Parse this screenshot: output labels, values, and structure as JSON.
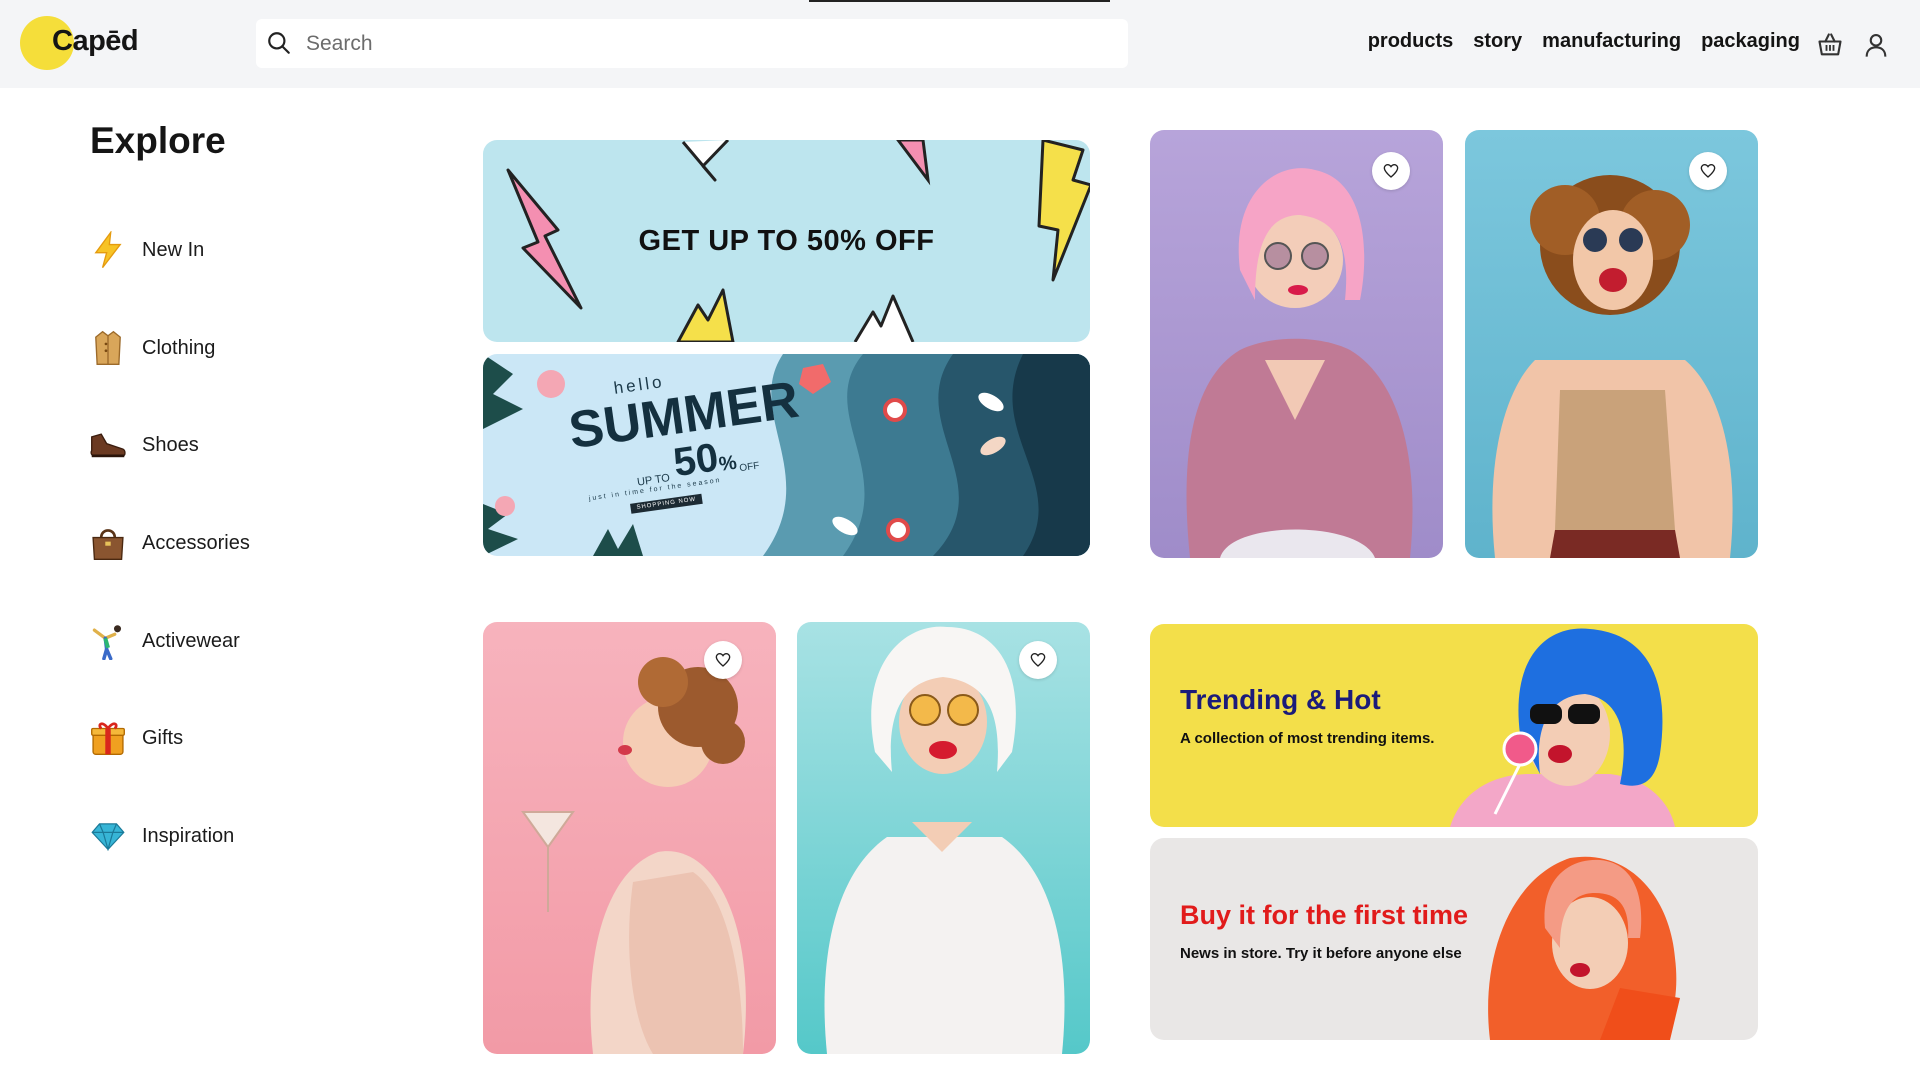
{
  "header": {
    "logo_text": "Capēd",
    "search_placeholder": "Search",
    "nav": [
      "products",
      "story",
      "manufacturing",
      "packaging"
    ]
  },
  "sidebar": {
    "title": "Explore",
    "items": [
      {
        "label": "New In",
        "icon": "lightning-icon"
      },
      {
        "label": "Clothing",
        "icon": "coat-icon"
      },
      {
        "label": "Shoes",
        "icon": "shoe-icon"
      },
      {
        "label": "Accessories",
        "icon": "handbag-icon"
      },
      {
        "label": "Activewear",
        "icon": "gymnast-icon"
      },
      {
        "label": "Gifts",
        "icon": "gift-icon"
      },
      {
        "label": "Inspiration",
        "icon": "gem-icon"
      }
    ]
  },
  "banners": {
    "sale_text": "GET UP TO 50% OFF",
    "summer": {
      "hello": "hello",
      "title": "SUMMER",
      "upto": "UP TO",
      "percent": "50",
      "pct_sign": "%",
      "off": "OFF",
      "small": "just in time for the season",
      "button": "SHOPPING NOW"
    }
  },
  "promos": {
    "trending": {
      "title": "Trending & Hot",
      "subtitle": "A collection of most trending items."
    },
    "first_time": {
      "title": "Buy it for the first time",
      "subtitle": "News in store. Try it before anyone else"
    }
  },
  "colors": {
    "logo_yellow": "#f5de3a",
    "trending_bg": "#f3df4a",
    "trending_title": "#1b1b7a",
    "first_time_title": "#e11b1b",
    "first_time_bg": "#e9e7e6"
  }
}
